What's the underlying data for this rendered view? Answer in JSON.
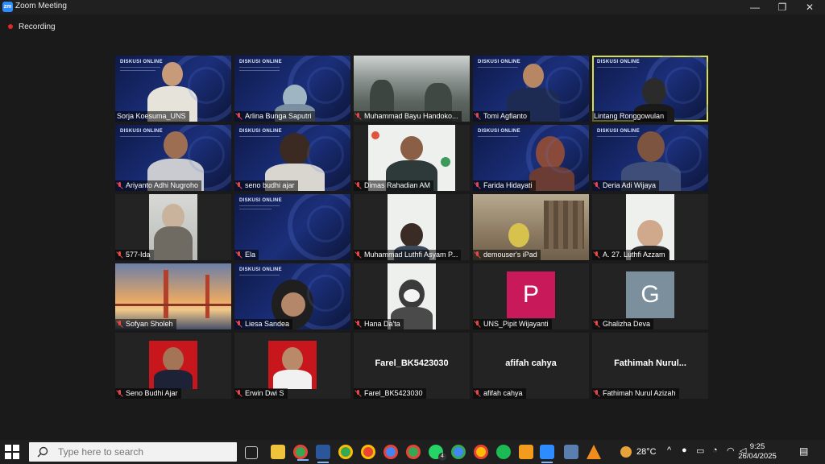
{
  "window": {
    "title": "Zoom Meeting",
    "minimize": "—",
    "restore": "❐",
    "close": "✕"
  },
  "recording": {
    "label": "Recording"
  },
  "tiles": [
    {
      "name": "Sorja Koesuma_UNS",
      "muted": false
    },
    {
      "name": "Arlina Bunga Saputri",
      "muted": true
    },
    {
      "name": "Muhammad Bayu Handoko...",
      "muted": true
    },
    {
      "name": "Tomi Agfianto",
      "muted": true
    },
    {
      "name": "Lintang Ronggowulan",
      "muted": false,
      "highlighted": true
    },
    {
      "name": "Ariyanto Adhi Nugroho",
      "muted": true
    },
    {
      "name": "seno budhi ajar",
      "muted": true
    },
    {
      "name": "Dimas Rahadian AM",
      "muted": true
    },
    {
      "name": "Farida Hidayati",
      "muted": true
    },
    {
      "name": "Deria Adi Wijaya",
      "muted": true
    },
    {
      "name": "577-Ida",
      "muted": true
    },
    {
      "name": "Ela",
      "muted": true
    },
    {
      "name": "Muhammad Luthfi Asyam P...",
      "muted": true
    },
    {
      "name": "demouser's iPad",
      "muted": true
    },
    {
      "name": "A. 27. Luthfi Azzam",
      "muted": true
    },
    {
      "name": "Sofyan Sholeh",
      "muted": true
    },
    {
      "name": "Liesa Sandea",
      "muted": true
    },
    {
      "name": "Hana Da'ta",
      "muted": true
    },
    {
      "name": "UNS_Pipit Wijayanti",
      "muted": true,
      "avatar_letter": "P",
      "avatar_color": "#c8195a"
    },
    {
      "name": "Ghalizha Deva",
      "muted": true,
      "avatar_letter": "G",
      "avatar_color": "#7b8f9c"
    },
    {
      "name": "Seno Budhi Ajar",
      "muted": true
    },
    {
      "name": "Erwin Dwi S",
      "muted": true
    },
    {
      "name": "Farel_BK5423030",
      "muted": true,
      "display_name": "Farel_BK5423030"
    },
    {
      "name": "afifah cahya",
      "muted": true,
      "display_name": "afifah cahya"
    },
    {
      "name": "Fathimah Nurul Azizah",
      "muted": true,
      "display_name": "Fathimah  Nurul..."
    }
  ],
  "slide": {
    "title": "DISKUSI ONLINE"
  },
  "taskbar": {
    "search_placeholder": "Type here to search",
    "whatsapp_badge": "4",
    "weather": "28°C",
    "time": "9:25",
    "date": "26/04/2025"
  },
  "colors": {
    "highlight": "#d9de4b",
    "muted_icon": "#e34848",
    "recording_dot": "#e02828"
  }
}
